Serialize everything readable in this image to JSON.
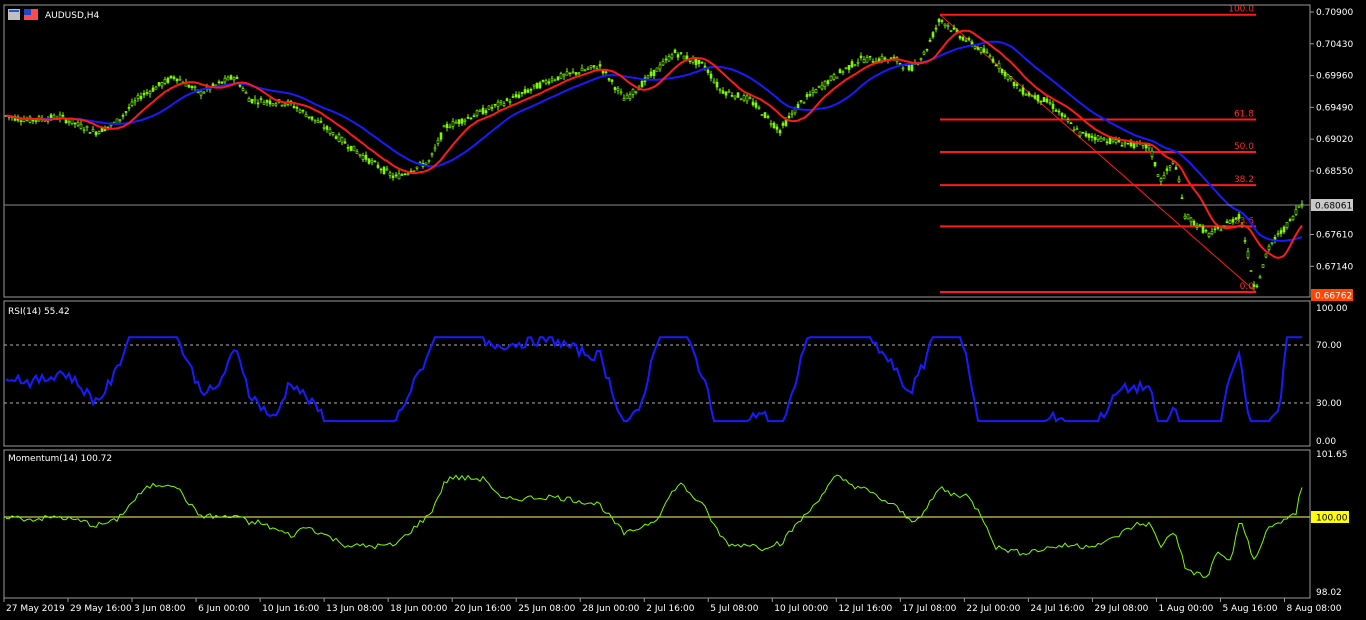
{
  "window": {
    "symbol_title": "AUDUSD,H4"
  },
  "colors": {
    "background": "#000000",
    "bull": "#7CFC00",
    "ma_fast": "#ff1a1a",
    "ma_slow": "#1a1aff",
    "fib": "#ff1a1a",
    "rsi": "#1a1aff",
    "momentum": "#7CFC00",
    "momentum_ref": "#ffff00",
    "bid_tag": "#c8c8c8",
    "low_tag": "#ff4500"
  },
  "price_panel": {
    "y_ticks": [
      "0.70900",
      "0.70430",
      "0.69960",
      "0.69490",
      "0.69020",
      "0.68550",
      "0.67610",
      "0.67140"
    ],
    "current_price": "0.68061",
    "low_price_tag": "0.66762",
    "fib_levels": [
      {
        "label": "100.0",
        "price": 0.7086
      },
      {
        "label": "61.8",
        "price": 0.6931
      },
      {
        "label": "50.0",
        "price": 0.6883
      },
      {
        "label": "38.2",
        "price": 0.6834
      },
      {
        "label": "23.6",
        "price": 0.6773
      },
      {
        "label": "0.0",
        "price": 0.6676
      }
    ]
  },
  "rsi_panel": {
    "title": "RSI(14) 55.42",
    "y_ticks": [
      "100.00",
      "70.00",
      "30.00",
      "0.00"
    ],
    "levels": [
      70,
      30
    ]
  },
  "momentum_panel": {
    "title": "Momentum(14) 100.72",
    "y_ticks": [
      "101.65",
      "98.02"
    ],
    "ref_value": "100.00"
  },
  "time_axis": [
    "27 May 2019",
    "29 May 16:00",
    "3 Jun 08:00",
    "6 Jun 00:00",
    "10 Jun 16:00",
    "13 Jun 08:00",
    "18 Jun 00:00",
    "20 Jun 16:00",
    "25 Jun 08:00",
    "28 Jun 00:00",
    "2 Jul 16:00",
    "5 Jul 08:00",
    "10 Jul 00:00",
    "12 Jul 16:00",
    "17 Jul 08:00",
    "22 Jul 00:00",
    "24 Jul 16:00",
    "29 Jul 08:00",
    "1 Aug 00:00",
    "5 Aug 16:00",
    "8 Aug 08:00"
  ],
  "chart_data": {
    "type": "line",
    "price_path": [
      [
        0,
        0.6938
      ],
      [
        30,
        0.693
      ],
      [
        60,
        0.6935
      ],
      [
        95,
        0.6912
      ],
      [
        115,
        0.6925
      ],
      [
        140,
        0.6965
      ],
      [
        175,
        0.6995
      ],
      [
        200,
        0.697
      ],
      [
        235,
        0.6995
      ],
      [
        250,
        0.696
      ],
      [
        290,
        0.6955
      ],
      [
        320,
        0.6925
      ],
      [
        360,
        0.688
      ],
      [
        395,
        0.6845
      ],
      [
        430,
        0.687
      ],
      [
        445,
        0.692
      ],
      [
        470,
        0.6935
      ],
      [
        510,
        0.696
      ],
      [
        550,
        0.699
      ],
      [
        600,
        0.701
      ],
      [
        625,
        0.696
      ],
      [
        650,
        0.6995
      ],
      [
        675,
        0.703
      ],
      [
        705,
        0.701
      ],
      [
        720,
        0.6975
      ],
      [
        750,
        0.696
      ],
      [
        780,
        0.6915
      ],
      [
        800,
        0.6955
      ],
      [
        830,
        0.699
      ],
      [
        860,
        0.702
      ],
      [
        895,
        0.702
      ],
      [
        910,
        0.7005
      ],
      [
        925,
        0.703
      ],
      [
        940,
        0.708
      ],
      [
        960,
        0.7055
      ],
      [
        990,
        0.7025
      ],
      [
        1020,
        0.6975
      ],
      [
        1050,
        0.6955
      ],
      [
        1080,
        0.691
      ],
      [
        1110,
        0.69
      ],
      [
        1150,
        0.689
      ],
      [
        1160,
        0.684
      ],
      [
        1175,
        0.687
      ],
      [
        1185,
        0.679
      ],
      [
        1210,
        0.676
      ],
      [
        1240,
        0.679
      ],
      [
        1255,
        0.668
      ],
      [
        1270,
        0.6745
      ],
      [
        1290,
        0.678
      ],
      [
        1300,
        0.6806
      ]
    ]
  }
}
